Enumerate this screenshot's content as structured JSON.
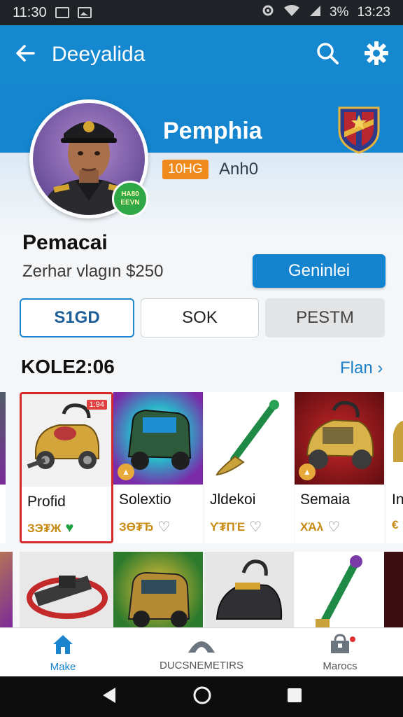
{
  "status_bar": {
    "time": "11:30",
    "battery": "3%",
    "clock_right": "13:23"
  },
  "app_bar": {
    "title": "Deeyalida",
    "back_icon": "back-arrow-icon",
    "search_icon": "search-icon",
    "settings_icon": "gear-icon"
  },
  "profile": {
    "hero_name": "Pemphia",
    "tag": "10HG",
    "sub": "Anh0",
    "badge_line1": "HA80",
    "badge_line2": "EEVN",
    "name": "Pemacai",
    "subtitle": "Zerhar vlagın $250",
    "action_label": "Geninlei"
  },
  "tabs": [
    {
      "label": "S1GD",
      "selected": true
    },
    {
      "label": "SOK",
      "selected": false
    },
    {
      "label": "PESTM",
      "selected": false
    }
  ],
  "section": {
    "title": "KOLE2:06",
    "link": "Flan",
    "link_icon": "chevron-right-icon"
  },
  "items": [
    {
      "name": "Profid",
      "price": "ЗЭ₮Ж",
      "tag": "1:94",
      "liked": true
    },
    {
      "name": "Solextio",
      "price": "ЗӨ₮Ђ",
      "liked": false
    },
    {
      "name": "Jldekoi",
      "price": "ϒ₮ΠΈ",
      "liked": false
    },
    {
      "name": "Semaia",
      "price": "ΧΆλ",
      "liked": false
    },
    {
      "name": "In",
      "price": "€",
      "liked": false
    }
  ],
  "bottom_nav": [
    {
      "label": "Make",
      "icon": "home-icon",
      "active": true
    },
    {
      "label": "DUCSNEMETIRS",
      "icon": "dome-icon",
      "active": false
    },
    {
      "label": "Marocs",
      "icon": "shop-icon",
      "active": false
    }
  ],
  "colors": {
    "primary": "#1688d0",
    "accent_orange": "#f08a1c",
    "selected_border": "#d42a2a",
    "price_gold": "#c88a12"
  }
}
